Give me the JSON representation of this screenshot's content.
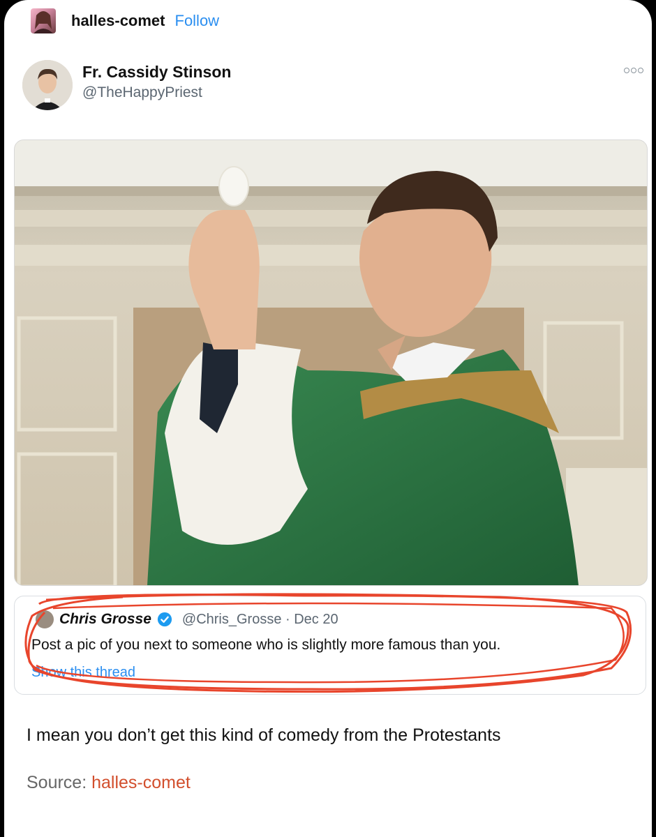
{
  "post": {
    "blog_name": "halles-comet",
    "follow_label": "Follow",
    "caption": "I mean you don’t get this kind of comedy from the Protestants",
    "source_label": "Source: ",
    "source_link": "halles-comet"
  },
  "tweet": {
    "display_name": "Fr. Cassidy Stinson",
    "handle": "@TheHappyPriest",
    "more_icon": "more-options-icon"
  },
  "quoted_tweet": {
    "display_name": "Chris Grosse",
    "verified_icon": "verified-badge-icon",
    "handle_date": "@Chris_Grosse · Dec 20",
    "text": "Post a pic of you next to someone who is slightly more famous than you.",
    "link": "Show this thread"
  },
  "colors": {
    "follow": "#2a8ef0",
    "source_link": "#d24e2c",
    "annotation": "#e8452c",
    "vestment": "#2f7a45"
  }
}
